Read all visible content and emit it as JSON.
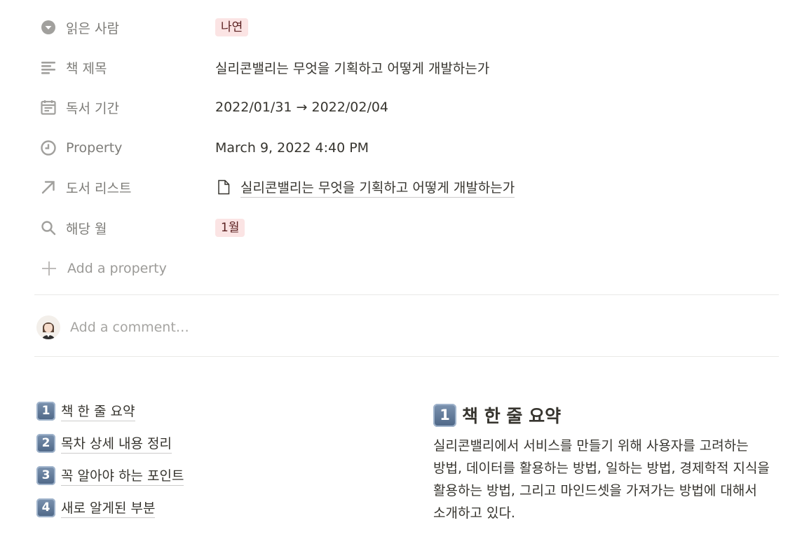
{
  "properties": [
    {
      "key": "읽은 사람",
      "icon": "select-icon",
      "value": "나연",
      "value_type": "tag",
      "tag_color": "#fbe4e4"
    },
    {
      "key": "책 제목",
      "icon": "text-icon",
      "value": "실리콘밸리는 무엇을 기획하고 어떻게 개발하는가",
      "value_type": "text"
    },
    {
      "key": "독서 기간",
      "icon": "calendar-icon",
      "value": "2022/01/31 → 2022/02/04",
      "value_type": "text"
    },
    {
      "key": "Property",
      "icon": "clock-icon",
      "value": "March 9, 2022 4:40 PM",
      "value_type": "text"
    },
    {
      "key": "도서 리스트",
      "icon": "relation-arrow-icon",
      "value": "실리콘밸리는 무엇을 기획하고 어떻게 개발하는가",
      "value_type": "relation"
    },
    {
      "key": "해당 월",
      "icon": "search-icon",
      "value": "1월",
      "value_type": "tag",
      "tag_color": "#fbe4e4"
    }
  ],
  "add_property_label": "Add a property",
  "comment_placeholder": "Add a comment…",
  "toc": [
    {
      "num": "1",
      "label": "책 한 줄 요약"
    },
    {
      "num": "2",
      "label": "목차 상세 내용 정리"
    },
    {
      "num": "3",
      "label": "꼭 알아야 하는 포인트"
    },
    {
      "num": "4",
      "label": "새로 알게된 부분"
    }
  ],
  "section": {
    "num": "1",
    "heading": "책 한 줄 요약",
    "body": "실리콘밸리에서 서비스를 만들기 위해 사용자를 고려하는 방법, 데이터를 활용하는 방법, 일하는 방법, 경제학적 지식을 활용하는 방법, 그리고 마인드셋을 가져가는 방법에 대해서 소개하고 있다."
  }
}
